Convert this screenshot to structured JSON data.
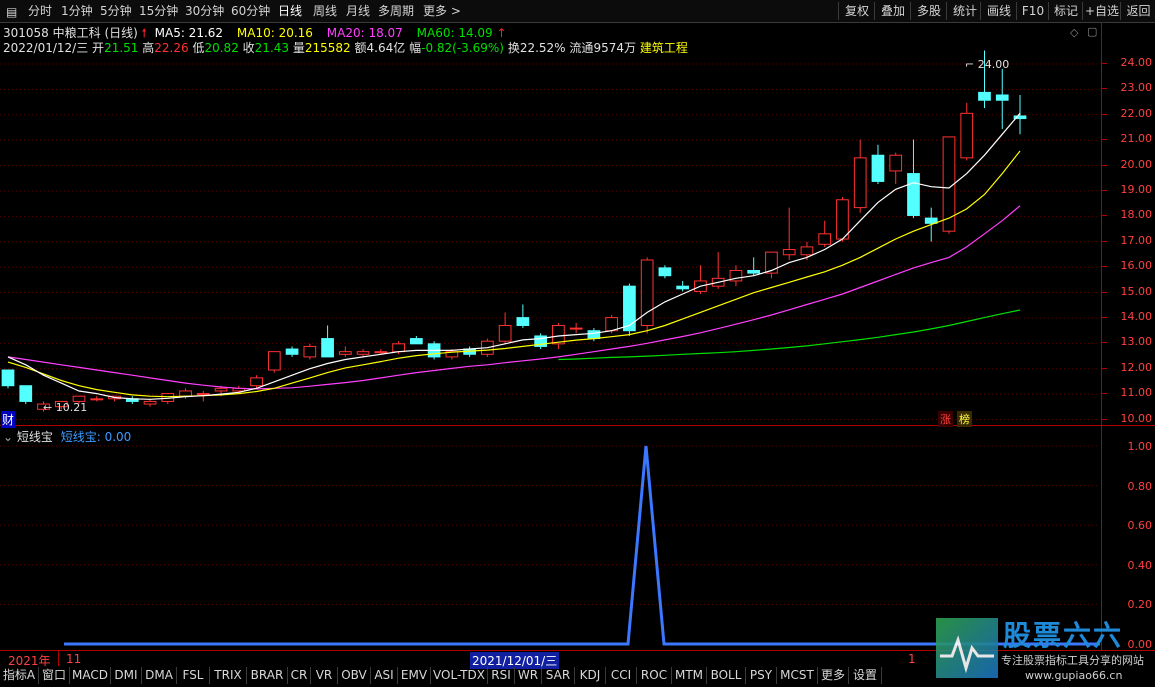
{
  "toolbar": {
    "periods": [
      "分时",
      "1分钟",
      "5分钟",
      "15分钟",
      "30分钟",
      "60分钟",
      "日线",
      "周线",
      "月线",
      "多周期",
      "更多 >"
    ],
    "active_period": "日线",
    "buttons": [
      "复权",
      "叠加",
      "多股",
      "统计",
      "画线",
      "F10",
      "标记",
      "+自选",
      "返回"
    ]
  },
  "stock": {
    "header": "301058 中粮工科 (日线)",
    "ma5": "MA5: 21.62",
    "ma10": "MA10: 20.16",
    "ma20": "MA20: 18.07",
    "ma60": "MA60: 14.09"
  },
  "quote": {
    "date": "2022/01/12/三",
    "open_label": "开",
    "open": "21.51",
    "high_label": "高",
    "high": "22.26",
    "low_label": "低",
    "low": "20.82",
    "close_label": "收",
    "close": "21.43",
    "vol_label": "量",
    "vol": "215582",
    "amount_label": "额",
    "amount": "4.64亿",
    "change_label": "幅",
    "change": "-0.82(-3.69%)",
    "turnover_label": "换",
    "turnover": "22.52%",
    "float_label": "流通",
    "float": "9574万",
    "industry": "建筑工程"
  },
  "price_axis": [
    "24.00",
    "23.00",
    "22.00",
    "21.00",
    "20.00",
    "19.00",
    "18.00",
    "17.00",
    "16.00",
    "15.00",
    "14.00",
    "13.00",
    "12.00",
    "11.00",
    "10.00"
  ],
  "markers": {
    "high": "24.00",
    "low": "10.21",
    "cai": "财",
    "zhang": "涨",
    "bang": "榜"
  },
  "indicator": {
    "name": "短线宝",
    "value_text": "短线宝: 0.00",
    "axis": [
      "1.00",
      "0.80",
      "0.60",
      "0.40",
      "0.20",
      "0.00"
    ]
  },
  "timeline": {
    "year": "2021年",
    "m11": "11",
    "cursor": "2021/12/01/三",
    "m1": "1"
  },
  "bottom_tabs": [
    "指标A",
    "窗口",
    "MACD",
    "DMI",
    "DMA",
    "FSL",
    "TRIX",
    "BRAR",
    "CR",
    "VR",
    "OBV",
    "ASI",
    "EMV",
    "VOL-TDX",
    "RSI",
    "WR",
    "SAR",
    "KDJ",
    "CCI",
    "ROC",
    "MTM",
    "BOLL",
    "PSY",
    "MCST",
    "更多",
    "设置"
  ],
  "watermark": {
    "title": "股票六六",
    "subtitle": "专注股票指标工具分享的网站",
    "url": "www.gupiao66.cn"
  },
  "colors": {
    "up": "#ff3232",
    "down": "#54ffff",
    "ma5": "#ffffff",
    "ma10": "#ffff00",
    "ma20": "#ff40ff",
    "ma60": "#00e000",
    "indicator": "#3b78ff",
    "axis": "#b00000"
  },
  "chart_data": {
    "type": "candlestick",
    "price_range": [
      9.7,
      24.4
    ],
    "candles": [
      [
        11.8,
        11.7,
        11.1,
        11.2
      ],
      [
        11.2,
        11.2,
        10.5,
        10.6
      ],
      [
        10.3,
        10.6,
        10.21,
        10.5
      ],
      [
        10.4,
        10.6,
        10.3,
        10.6
      ],
      [
        10.6,
        10.8,
        10.5,
        10.8
      ],
      [
        10.7,
        10.8,
        10.6,
        10.7
      ],
      [
        10.7,
        10.8,
        10.6,
        10.8
      ],
      [
        10.7,
        10.8,
        10.5,
        10.6
      ],
      [
        10.5,
        10.7,
        10.4,
        10.6
      ],
      [
        10.6,
        10.9,
        10.5,
        10.9
      ],
      [
        10.8,
        11.1,
        10.7,
        11.0
      ],
      [
        10.9,
        11.0,
        10.6,
        10.9
      ],
      [
        11.0,
        11.2,
        10.8,
        11.1
      ],
      [
        11.0,
        11.2,
        10.9,
        11.1
      ],
      [
        11.2,
        11.6,
        11.1,
        11.5
      ],
      [
        11.8,
        12.5,
        11.7,
        12.5
      ],
      [
        12.6,
        12.7,
        12.3,
        12.4
      ],
      [
        12.3,
        12.8,
        12.2,
        12.7
      ],
      [
        13.0,
        13.5,
        12.4,
        12.3
      ],
      [
        12.4,
        12.7,
        12.3,
        12.5
      ],
      [
        12.4,
        12.6,
        12.3,
        12.5
      ],
      [
        12.5,
        12.6,
        12.4,
        12.5
      ],
      [
        12.5,
        12.9,
        12.4,
        12.8
      ],
      [
        13.0,
        13.1,
        12.8,
        12.8
      ],
      [
        12.8,
        12.9,
        12.2,
        12.3
      ],
      [
        12.3,
        12.6,
        12.2,
        12.5
      ],
      [
        12.6,
        12.7,
        12.3,
        12.4
      ],
      [
        12.4,
        13.0,
        12.3,
        12.9
      ],
      [
        12.9,
        14.0,
        12.8,
        13.5
      ],
      [
        13.8,
        14.3,
        13.4,
        13.5
      ],
      [
        13.1,
        13.2,
        12.6,
        12.7
      ],
      [
        12.8,
        13.6,
        12.6,
        13.5
      ],
      [
        13.4,
        13.6,
        13.2,
        13.4
      ],
      [
        13.3,
        13.4,
        12.9,
        13.0
      ],
      [
        13.3,
        13.9,
        13.2,
        13.8
      ],
      [
        15.0,
        15.1,
        13.1,
        13.3
      ],
      [
        13.5,
        16.1,
        13.2,
        16.0
      ],
      [
        15.7,
        15.8,
        15.3,
        15.4
      ],
      [
        15.0,
        15.2,
        14.8,
        14.9
      ],
      [
        14.8,
        15.8,
        14.7,
        15.2
      ],
      [
        15.0,
        16.3,
        14.9,
        15.3
      ],
      [
        15.2,
        15.8,
        15.0,
        15.6
      ],
      [
        15.6,
        16.1,
        15.4,
        15.5
      ],
      [
        15.5,
        16.3,
        15.3,
        16.3
      ],
      [
        16.2,
        18.0,
        16.0,
        16.4
      ],
      [
        16.2,
        16.7,
        16.0,
        16.5
      ],
      [
        16.6,
        17.5,
        16.5,
        17.0
      ],
      [
        16.8,
        18.4,
        16.7,
        18.3
      ],
      [
        18.0,
        20.6,
        17.8,
        19.9
      ],
      [
        20.0,
        20.4,
        18.9,
        19.0
      ],
      [
        19.4,
        20.1,
        18.9,
        20.0
      ],
      [
        19.3,
        20.6,
        17.6,
        17.7
      ],
      [
        17.6,
        18.0,
        16.7,
        17.4
      ],
      [
        17.1,
        20.6,
        17.0,
        20.7
      ],
      [
        19.9,
        22.0,
        19.8,
        21.6
      ],
      [
        22.4,
        24.0,
        21.8,
        22.1
      ],
      [
        22.3,
        23.3,
        21.0,
        22.1
      ],
      [
        21.5,
        22.3,
        20.8,
        21.4
      ]
    ],
    "ma5": [
      12.3,
      12.0,
      11.6,
      11.3,
      11.0,
      10.9,
      10.75,
      10.7,
      10.68,
      10.72,
      10.78,
      10.82,
      10.88,
      10.95,
      11.1,
      11.35,
      11.6,
      11.85,
      12.05,
      12.2,
      12.3,
      12.4,
      12.5,
      12.55,
      12.55,
      12.55,
      12.6,
      12.65,
      12.8,
      12.95,
      13.0,
      13.1,
      13.15,
      13.2,
      13.3,
      13.5,
      14.0,
      14.4,
      14.7,
      15.0,
      15.15,
      15.3,
      15.4,
      15.6,
      15.9,
      16.1,
      16.4,
      16.8,
      17.5,
      18.2,
      18.7,
      18.95,
      18.8,
      18.75,
      19.3,
      20.0,
      20.8,
      21.6
    ],
    "ma10": [
      12.1,
      11.9,
      11.65,
      11.4,
      11.2,
      11.05,
      10.95,
      10.85,
      10.8,
      10.78,
      10.8,
      10.82,
      10.85,
      10.9,
      10.98,
      11.1,
      11.3,
      11.5,
      11.7,
      11.88,
      12.0,
      12.12,
      12.25,
      12.35,
      12.42,
      12.48,
      12.52,
      12.56,
      12.62,
      12.7,
      12.78,
      12.86,
      12.94,
      13.0,
      13.07,
      13.15,
      13.3,
      13.5,
      13.75,
      14.0,
      14.25,
      14.5,
      14.75,
      14.95,
      15.15,
      15.35,
      15.55,
      15.8,
      16.1,
      16.45,
      16.8,
      17.1,
      17.35,
      17.6,
      17.95,
      18.5,
      19.3,
      20.16
    ],
    "ma20": [
      12.3,
      12.2,
      12.1,
      12.0,
      11.9,
      11.8,
      11.7,
      11.6,
      11.5,
      11.4,
      11.3,
      11.22,
      11.15,
      11.1,
      11.08,
      11.1,
      11.12,
      11.18,
      11.25,
      11.32,
      11.4,
      11.5,
      11.6,
      11.7,
      11.78,
      11.86,
      11.94,
      12.0,
      12.08,
      12.15,
      12.22,
      12.3,
      12.4,
      12.5,
      12.6,
      12.7,
      12.82,
      12.95,
      13.08,
      13.22,
      13.38,
      13.55,
      13.72,
      13.9,
      14.1,
      14.3,
      14.5,
      14.7,
      14.95,
      15.2,
      15.45,
      15.7,
      15.9,
      16.1,
      16.5,
      17.0,
      17.5,
      18.07
    ],
    "ma60": [
      12.2,
      12.22,
      12.25,
      12.28,
      12.3,
      12.33,
      12.36,
      12.4,
      12.43,
      12.46,
      12.5,
      12.55,
      12.6,
      12.66,
      12.72,
      12.8,
      12.88,
      12.96,
      13.05,
      13.15,
      13.25,
      13.37,
      13.5,
      13.65,
      13.8,
      13.95,
      14.09
    ],
    "indicator": {
      "name": "短线宝",
      "values": [
        0,
        0,
        0,
        0,
        1,
        0,
        0,
        0,
        0
      ],
      "ylim": [
        0,
        1.0
      ]
    }
  }
}
